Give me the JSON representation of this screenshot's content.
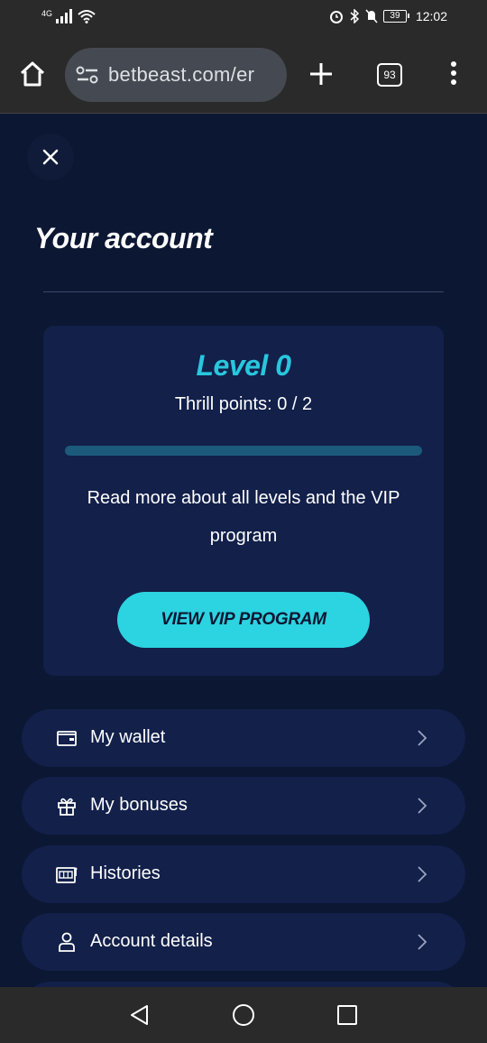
{
  "status_bar": {
    "network": "4G",
    "battery": "39",
    "time": "12:02"
  },
  "browser": {
    "url": "betbeast.com/er",
    "tab_count": "93"
  },
  "page": {
    "title": "Your account"
  },
  "vip": {
    "level": "Level 0",
    "thrill_points": "Thrill points: 0 / 2",
    "progress_fraction": 0,
    "description": "Read more about all levels and the VIP program",
    "button_label": "VIEW VIP PROGRAM"
  },
  "menu": {
    "items": [
      {
        "label": "My wallet",
        "icon": "wallet-icon"
      },
      {
        "label": "My bonuses",
        "icon": "gift-icon"
      },
      {
        "label": "Histories",
        "icon": "slot-machine-icon"
      },
      {
        "label": "Account details",
        "icon": "user-icon"
      }
    ]
  },
  "colors": {
    "background": "#0c1733",
    "card": "#12204a",
    "accent": "#2cd3e0",
    "level_text": "#29c6dd"
  }
}
